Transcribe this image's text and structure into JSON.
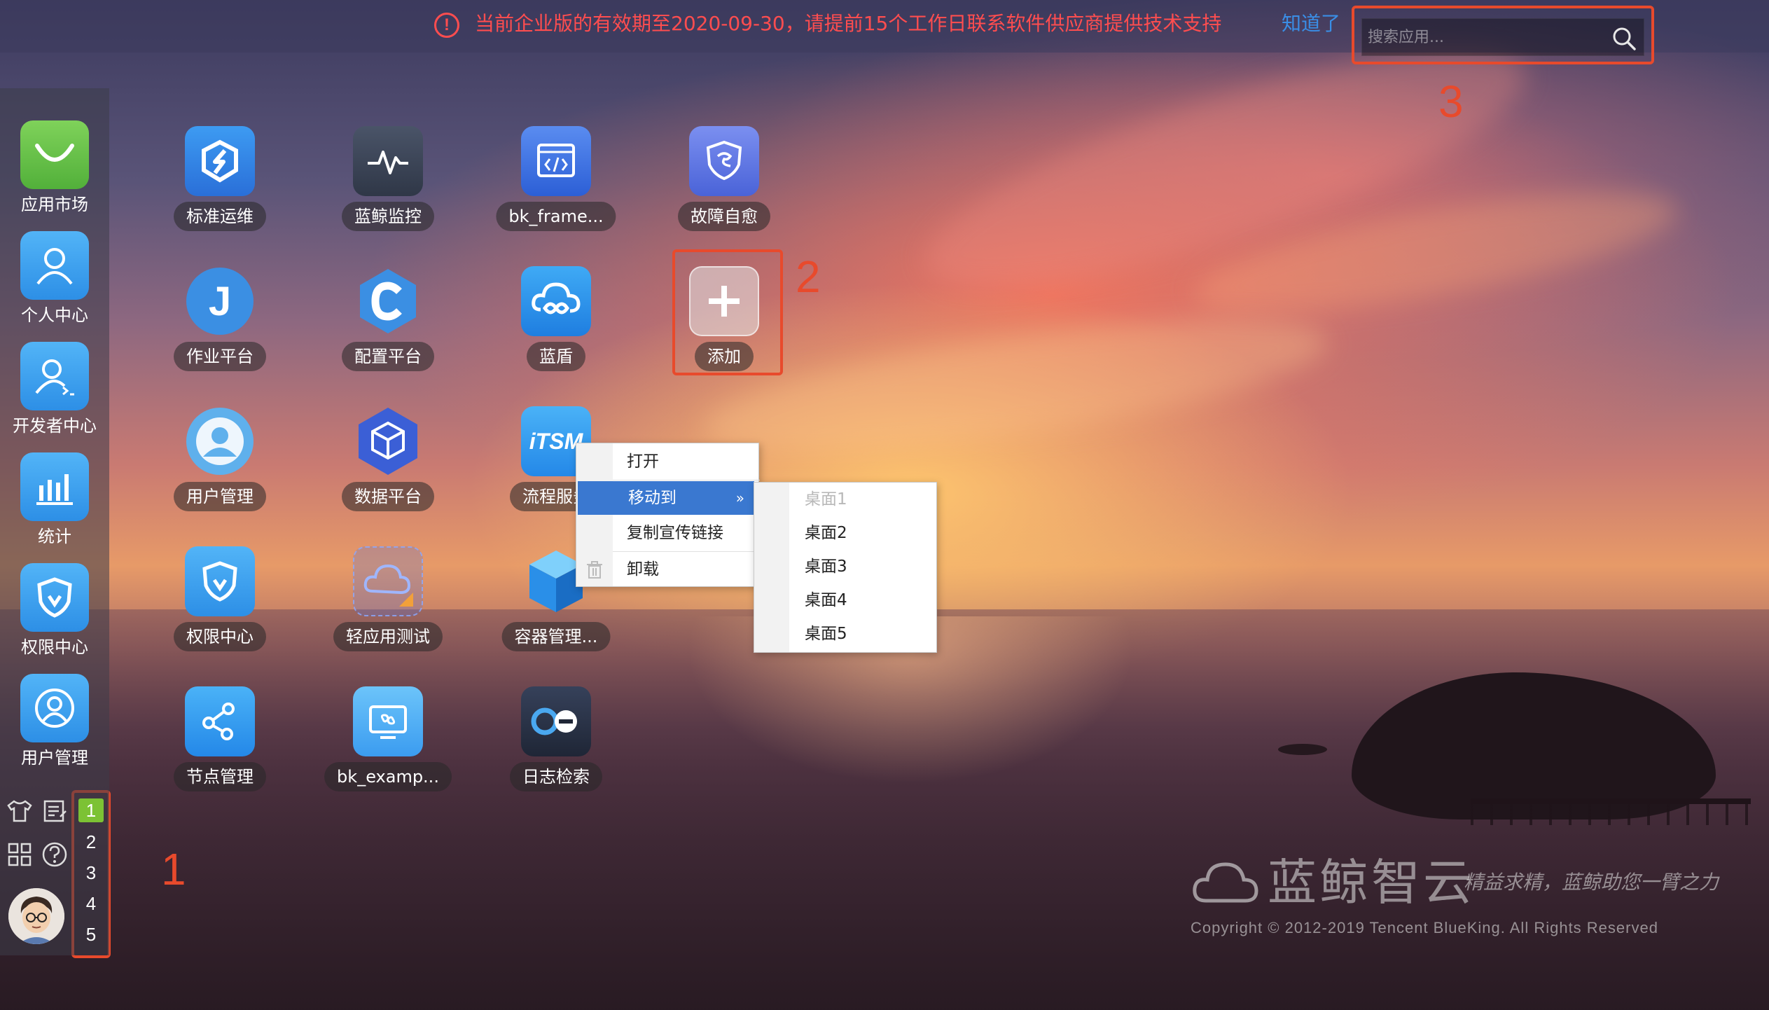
{
  "notice": {
    "message": "当前企业版的有效期至2020-09-30，请提前15个工作日联系软件供应商提供技术支持",
    "dismiss_label": "知道了"
  },
  "search": {
    "placeholder": "搜索应用..."
  },
  "annotations": {
    "n1": "1",
    "n2": "2",
    "n3": "3"
  },
  "dock": {
    "items": [
      {
        "label": "应用市场",
        "icon": "shopping-bag-icon",
        "color": "#62bd40"
      },
      {
        "label": "个人中心",
        "icon": "user-icon",
        "color": "#3b9cf0"
      },
      {
        "label": "开发者中心",
        "icon": "developer-icon",
        "color": "#3b9cf0"
      },
      {
        "label": "统计",
        "icon": "bar-chart-icon",
        "color": "#3b9cf0"
      },
      {
        "label": "权限中心",
        "icon": "shield-icon",
        "color": "#3b9cf0"
      },
      {
        "label": "用户管理",
        "icon": "user-circle-icon",
        "color": "#3b9cf0"
      }
    ],
    "desktops": [
      "1",
      "2",
      "3",
      "4",
      "5"
    ],
    "active_desktop": "1"
  },
  "apps": [
    {
      "label": "标准运维",
      "icon": "sops-icon",
      "color": "#2f7de1"
    },
    {
      "label": "蓝鲸监控",
      "icon": "monitor-icon",
      "color": "#3c4557"
    },
    {
      "label": "bk_frame...",
      "icon": "code-window-icon",
      "color": "#3b6fe0"
    },
    {
      "label": "故障自愈",
      "icon": "shield-heal-icon",
      "color": "#5a7ae8"
    },
    {
      "label": "作业平台",
      "icon": "letter-j-icon",
      "color": "#3b8fe3"
    },
    {
      "label": "配置平台",
      "icon": "letter-c-icon",
      "color": "#3b8fe3"
    },
    {
      "label": "蓝盾",
      "icon": "devops-cloud-icon",
      "color": "#2a8fe8"
    },
    {
      "label": "添加",
      "icon": "plus-icon",
      "color": "#d8d8d8"
    },
    {
      "label": "用户管理",
      "icon": "user-circle-icon",
      "color": "#5fb0ec"
    },
    {
      "label": "数据平台",
      "icon": "cube-icon",
      "color": "#3b5fd6"
    },
    {
      "label": "流程服务",
      "icon": "itsm-icon",
      "color": "#3b9cf0"
    },
    {
      "label": "权限中心",
      "icon": "shield-icon",
      "color": "#3b9cf0"
    },
    {
      "label": "轻应用测试",
      "icon": "cloud-light-app-icon",
      "color": "#5a7ae8"
    },
    {
      "label": "容器管理...",
      "icon": "container-cube-icon",
      "color": "#3b9cf0"
    },
    {
      "label": "节点管理",
      "icon": "nodes-icon",
      "color": "#3b8fe3"
    },
    {
      "label": "bk_examp...",
      "icon": "monitor-screen-icon",
      "color": "#3b9cf0"
    },
    {
      "label": "日志检索",
      "icon": "log-search-icon",
      "color": "#2a3348"
    }
  ],
  "context_menu": {
    "items": [
      "打开",
      "移动到",
      "复制宣传链接",
      "卸载"
    ],
    "submenu": [
      "桌面1",
      "桌面2",
      "桌面3",
      "桌面4",
      "桌面5"
    ]
  },
  "brand": {
    "name": "蓝鲸智云",
    "slogan": "精益求精，蓝鲸助您一臂之力",
    "copyright": "Copyright © 2012-2019 Tencent BlueKing. All Rights Reserved"
  }
}
